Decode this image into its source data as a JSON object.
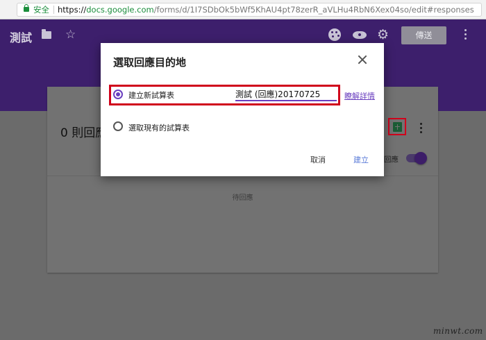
{
  "browser": {
    "secure_label": "安全",
    "url_scheme": "https://",
    "url_host": "docs.google.com",
    "url_path": "/forms/d/1I7SDbOk5bWf5KhAU4pt78zerR_aVLHu4RbN6Xex04so/edit#responses"
  },
  "header": {
    "title": "測試",
    "send_label": "傳送"
  },
  "responses": {
    "count_label": "0 則回應",
    "accepting_label": "回應",
    "pending_label": "待回應"
  },
  "dialog": {
    "title": "選取回應目的地",
    "option_new_label": "建立新試算表",
    "spreadsheet_name": "測試 (回應)20170725",
    "learn_more": "瞭解詳情",
    "option_existing_label": "選取現有的試算表",
    "cancel_label": "取消",
    "create_label": "建立",
    "selected_option": "new"
  },
  "watermark": "minwt.com",
  "colors": {
    "accent": "#6a3fbf",
    "highlight": "#d0011b",
    "sheets_green": "#1a5c34"
  }
}
